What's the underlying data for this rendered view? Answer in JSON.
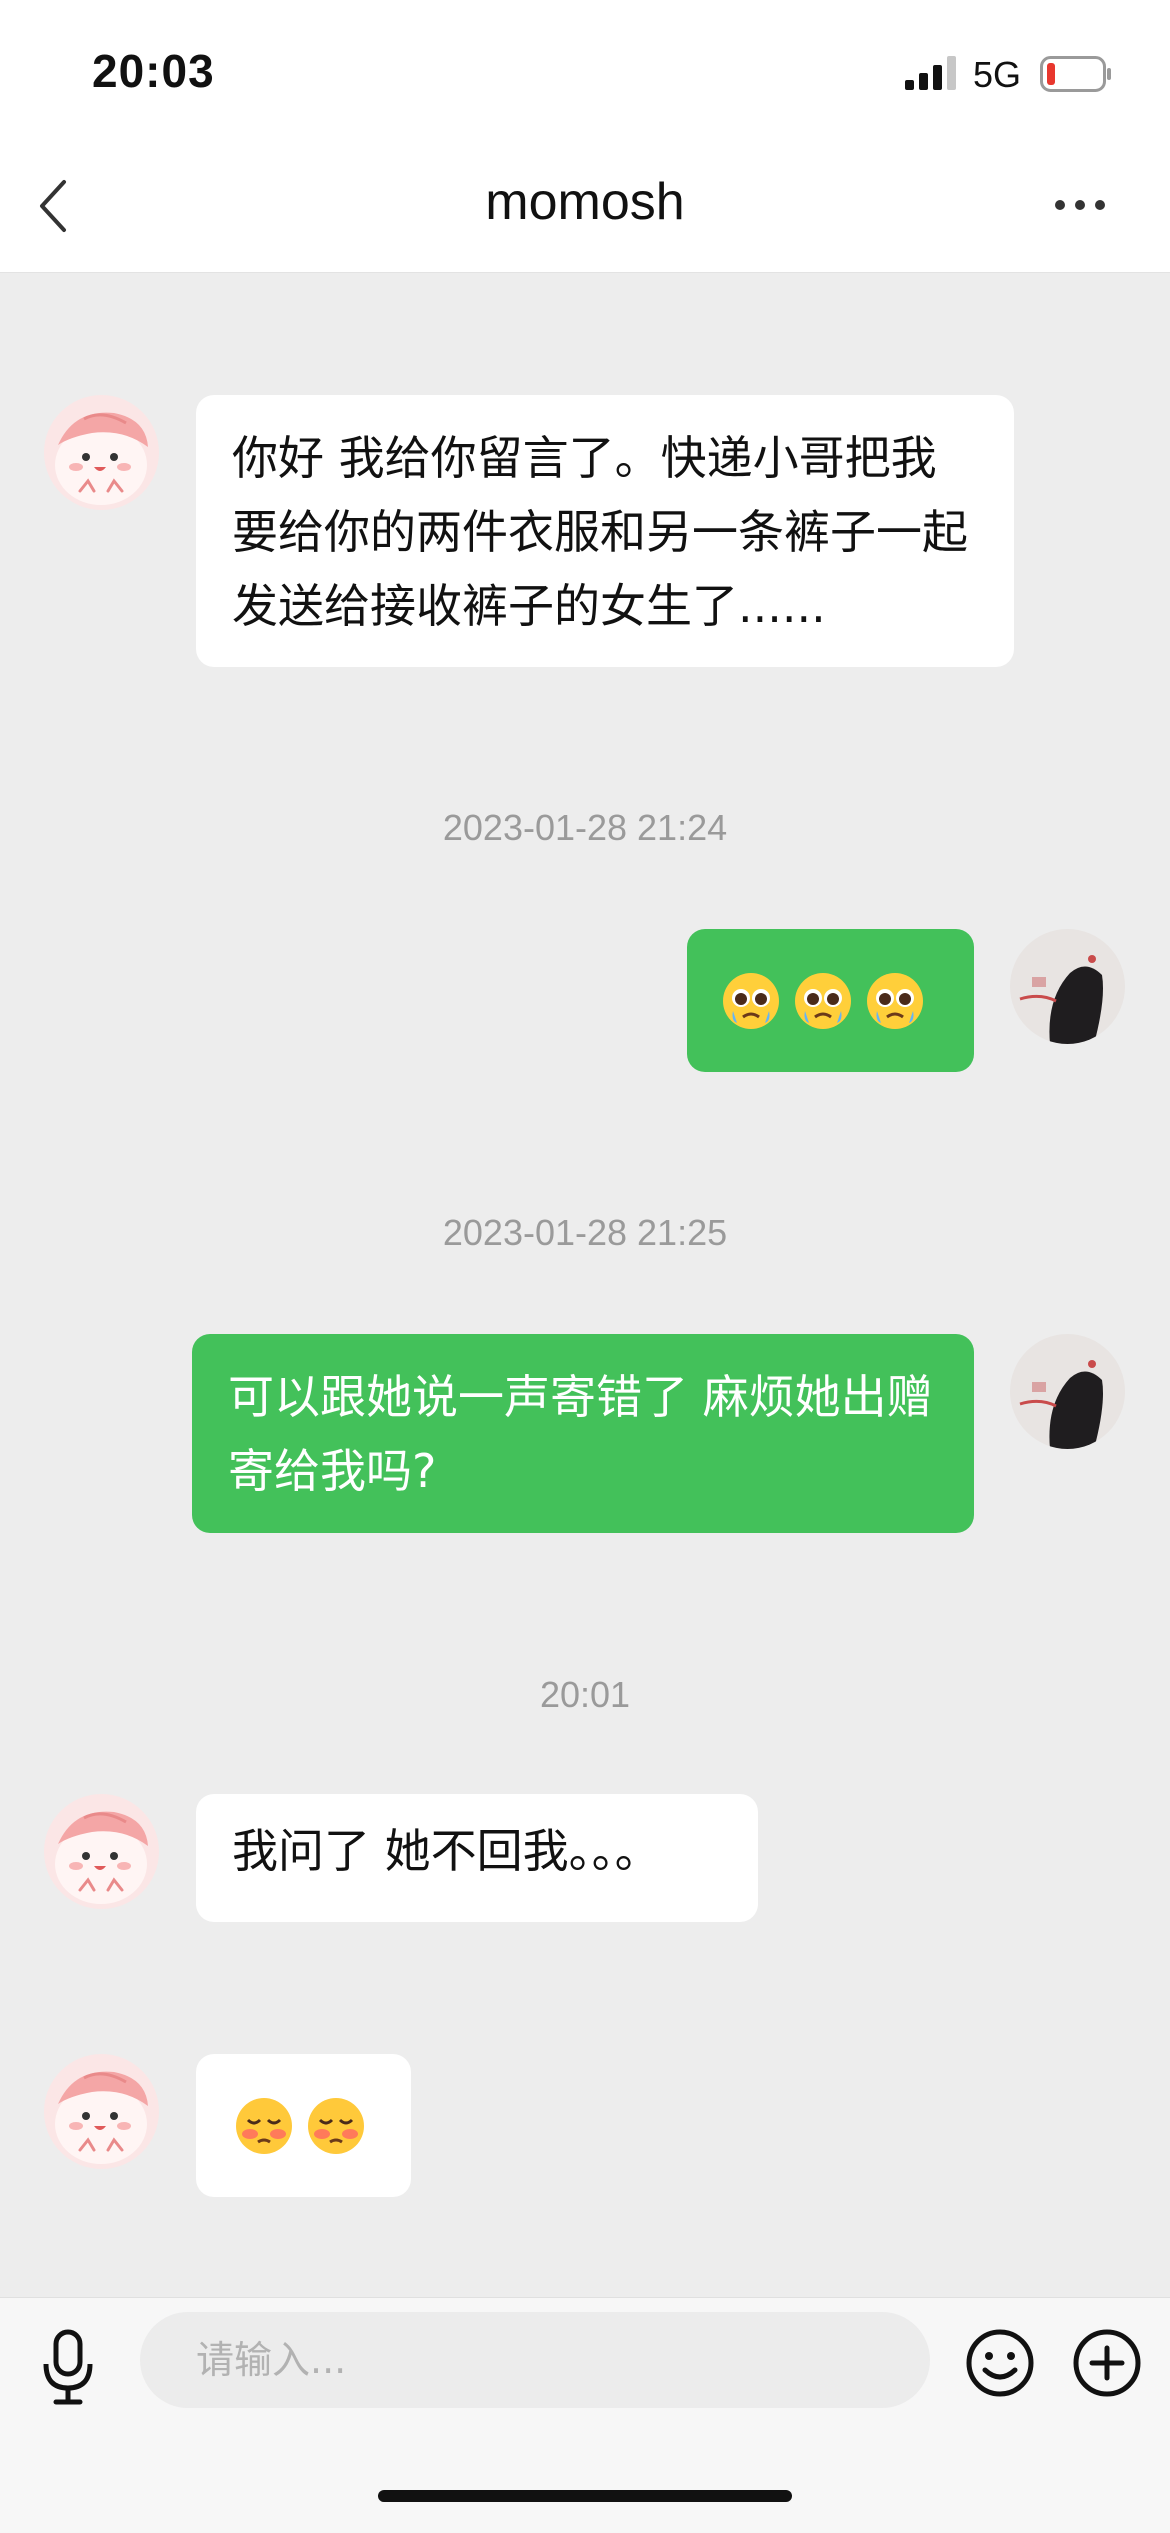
{
  "status_bar": {
    "time": "20:03",
    "network": "5G",
    "battery_color": "#e8372e"
  },
  "header": {
    "title": "momosh",
    "back_icon": "chevron-left-icon",
    "more_icon": "more-horizontal-icon"
  },
  "messages": [
    {
      "side": "in",
      "text": "你好 我给你留言了。快递小哥把我要给你的两件衣服和另一条裤子一起发送给接收裤子的女生了......"
    },
    {
      "timestamp": "2023-01-28 21:24"
    },
    {
      "side": "out",
      "emoji": [
        "pleading-face",
        "pleading-face",
        "pleading-face"
      ]
    },
    {
      "timestamp": "2023-01-28 21:25"
    },
    {
      "side": "out",
      "text": "可以跟她说一声寄错了  麻烦她出赠寄给我吗?"
    },
    {
      "timestamp": "20:01"
    },
    {
      "side": "in",
      "text": "我问了 她不回我。。。"
    },
    {
      "side": "in",
      "emoji": [
        "flushed-pleading-face",
        "flushed-pleading-face"
      ]
    }
  ],
  "input_bar": {
    "placeholder": "请输入...",
    "value": ""
  },
  "colors": {
    "outgoing_bubble": "#43c15a",
    "incoming_bubble": "#ffffff",
    "background": "#ededed"
  }
}
